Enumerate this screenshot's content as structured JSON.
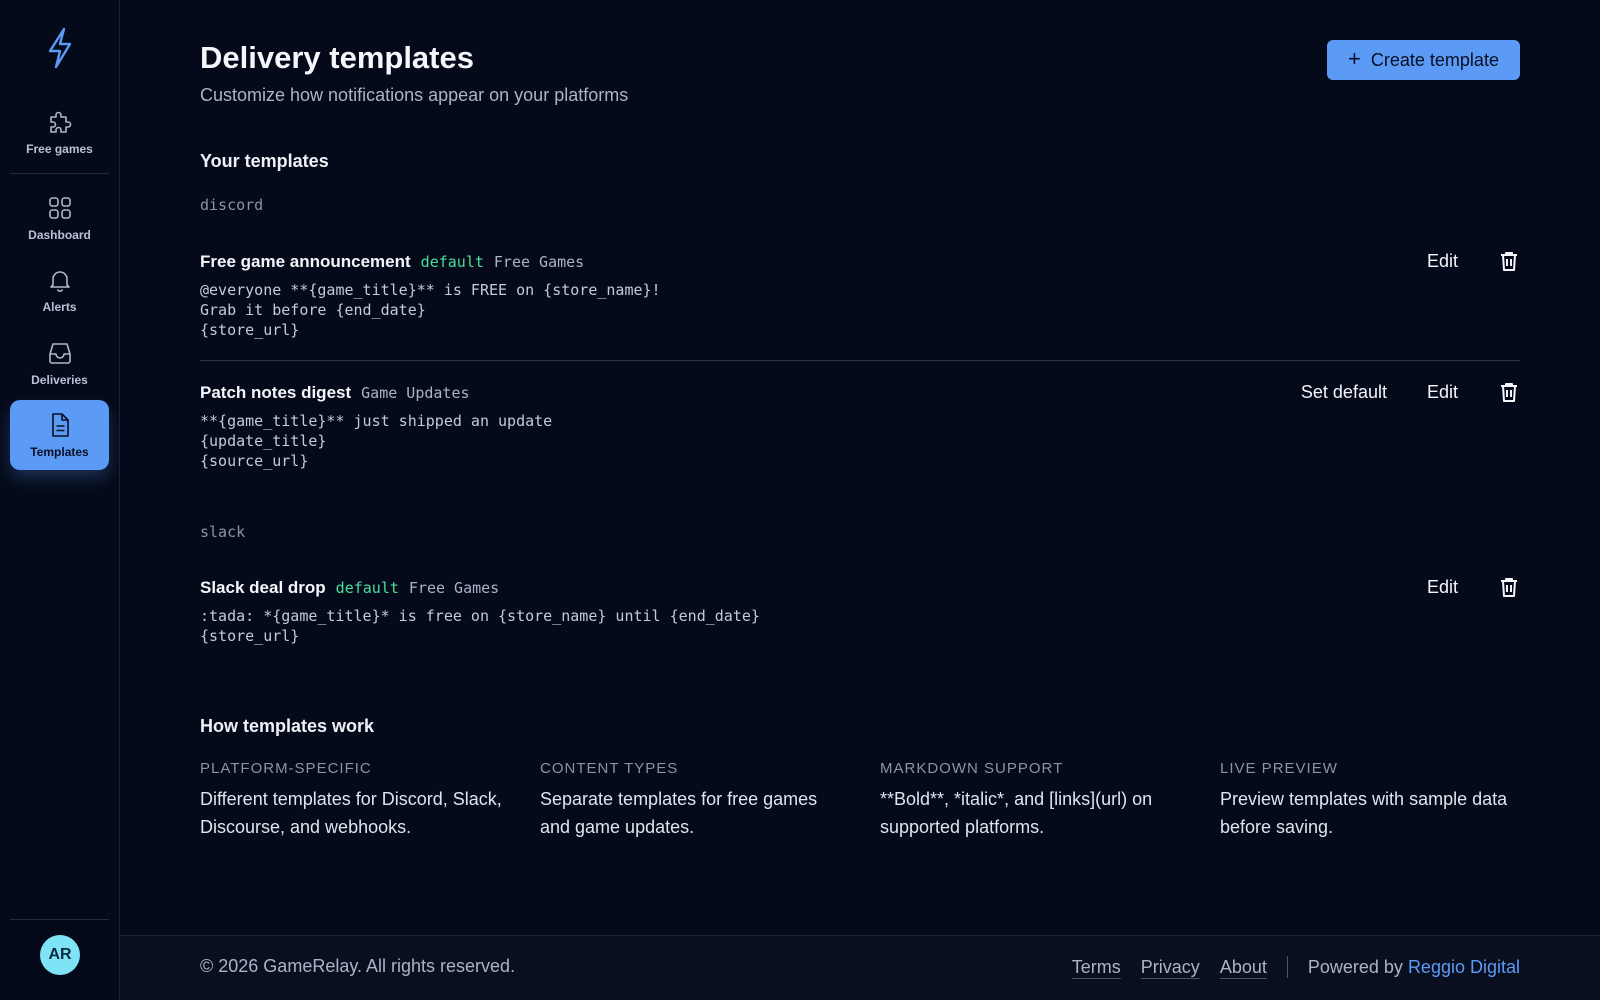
{
  "sidebar": {
    "items": [
      {
        "label": "Free games",
        "icon": "puzzle-icon"
      },
      {
        "label": "Dashboard",
        "icon": "grid-icon"
      },
      {
        "label": "Alerts",
        "icon": "bell-icon"
      },
      {
        "label": "Deliveries",
        "icon": "inbox-icon"
      },
      {
        "label": "Templates",
        "icon": "document-icon",
        "active": true
      }
    ],
    "avatar": "AR"
  },
  "header": {
    "title": "Delivery templates",
    "subtitle": "Customize how notifications appear on your platforms",
    "create_label": "Create template"
  },
  "templates": {
    "section_title": "Your templates",
    "groups": [
      {
        "platform": "discord",
        "items": [
          {
            "name": "Free game announcement",
            "default": "default",
            "type": "Free Games",
            "body": "@everyone **{game_title}** is FREE on {store_name}!\nGrab it before {end_date}\n{store_url}",
            "edit": "Edit"
          },
          {
            "name": "Patch notes digest",
            "type": "Game Updates",
            "body": "**{game_title}** just shipped an update\n{update_title}\n{source_url}",
            "set_default": "Set default",
            "edit": "Edit"
          }
        ]
      },
      {
        "platform": "slack",
        "items": [
          {
            "name": "Slack deal drop",
            "default": "default",
            "type": "Free Games",
            "body": ":tada: *{game_title}* is free on {store_name} until {end_date}\n{store_url}",
            "edit": "Edit"
          }
        ]
      }
    ]
  },
  "how": {
    "title": "How templates work",
    "columns": [
      {
        "heading": "PLATFORM-SPECIFIC",
        "text": "Different templates for Discord, Slack, Discourse, and webhooks."
      },
      {
        "heading": "CONTENT TYPES",
        "text": "Separate templates for free games and game updates."
      },
      {
        "heading": "MARKDOWN SUPPORT",
        "text": "**Bold**, *italic*, and [links](url) on supported platforms."
      },
      {
        "heading": "LIVE PREVIEW",
        "text": "Preview templates with sample data before saving."
      }
    ]
  },
  "footer": {
    "copyright": "© 2026 GameRelay. All rights reserved.",
    "links": [
      "Terms",
      "Privacy",
      "About"
    ],
    "powered_by": "Powered by",
    "brand": "Reggio Digital"
  },
  "colors": {
    "background": "#050a1a",
    "accent": "#5b9af5",
    "default_tag": "#4ade9a",
    "avatar": "#7ee3f4"
  }
}
